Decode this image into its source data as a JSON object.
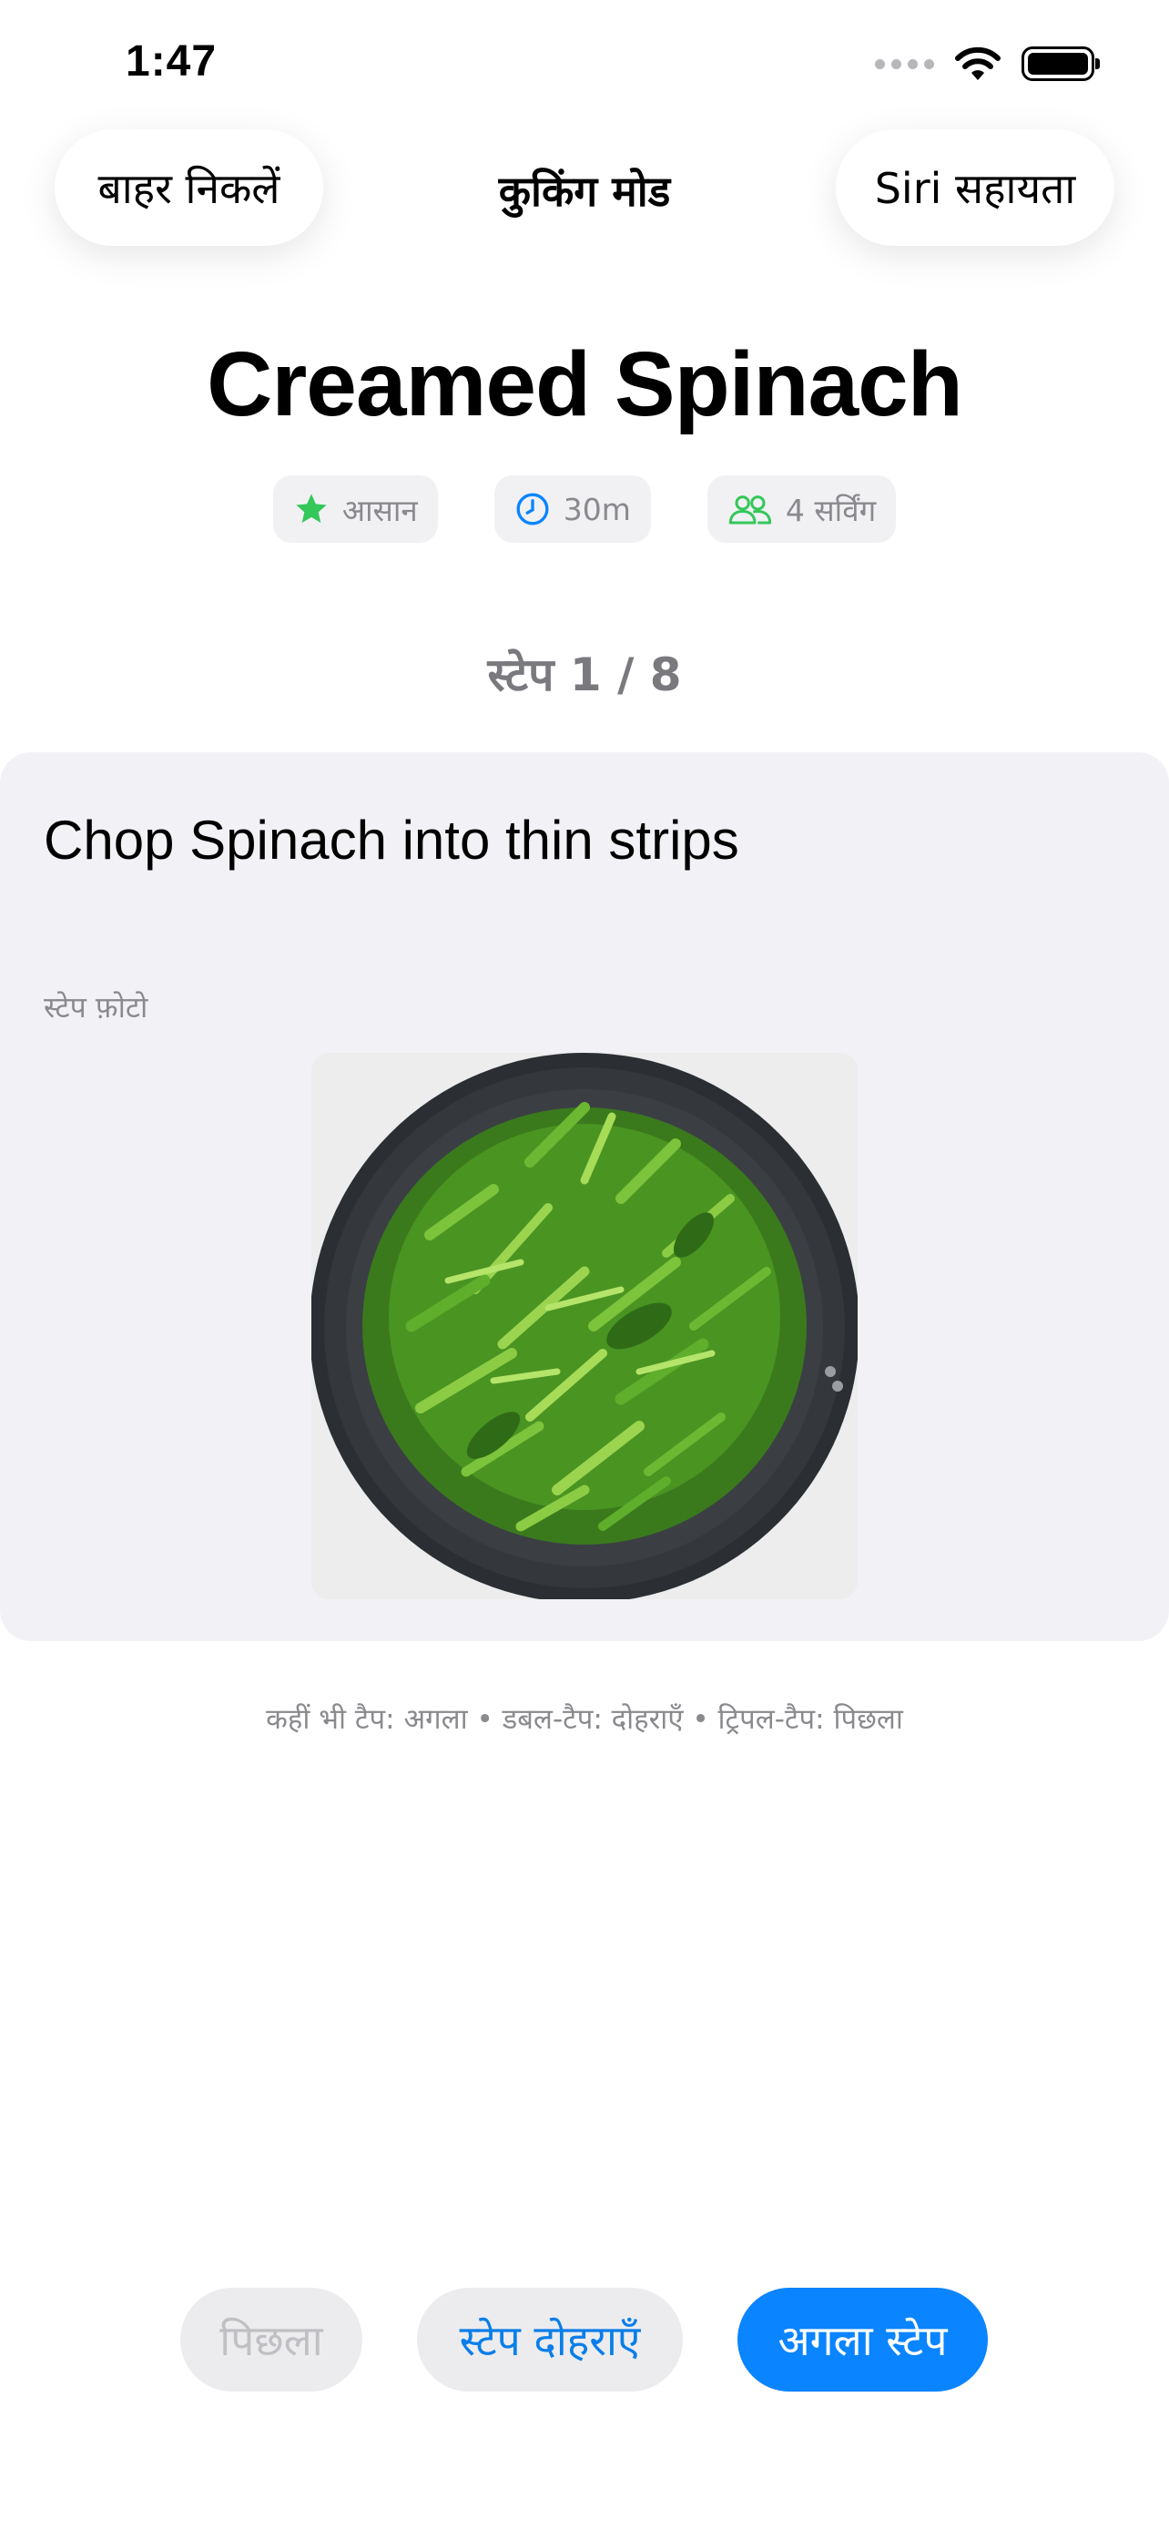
{
  "status_bar": {
    "time": "1:47",
    "icons": [
      "cellular-signal-icon",
      "wifi-icon",
      "battery-icon"
    ]
  },
  "nav": {
    "exit_label": "बाहर निकलें",
    "title": "कुकिंग मोड",
    "siri_label": "Siri सहायता"
  },
  "recipe": {
    "title": "Creamed Spinach",
    "chips": [
      {
        "icon": "star-icon",
        "label": "आसान",
        "icon_color": "#34c759"
      },
      {
        "icon": "clock-icon",
        "label": "30m",
        "icon_color": "#0a84ff"
      },
      {
        "icon": "people-icon",
        "label": "4 सर्विंग",
        "icon_color": "#34c759"
      }
    ]
  },
  "step": {
    "counter": "स्टेप 1 / 8",
    "instruction": "Chop Spinach into thin strips",
    "photo_label": "स्टेप फ़ोटो"
  },
  "gesture_hint": "कहीं भी टैप: अगला • डबल-टैप: दोहराएँ • ट्रिपल-टैप: पिछला",
  "controls": {
    "previous_label": "पिछला",
    "repeat_label": "स्टेप दोहराएँ",
    "next_label": "अगला स्टेप"
  },
  "colors": {
    "accent": "#0a84ff",
    "success": "#34c759",
    "card_background": "#f2f2f6",
    "secondary_text": "#8a8a8e"
  }
}
